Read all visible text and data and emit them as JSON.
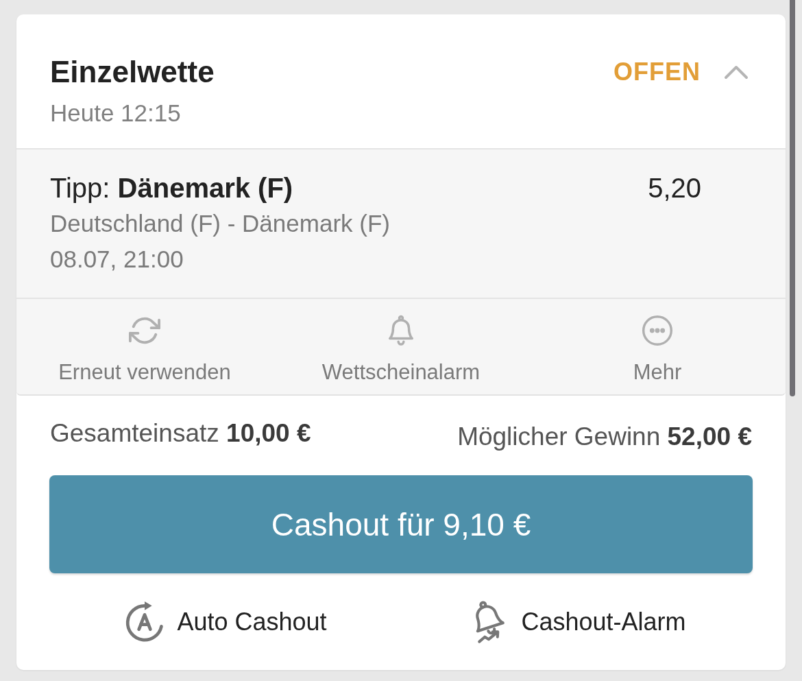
{
  "bet": {
    "type": "Einzelwette",
    "placed": "Heute 12:15",
    "status": "OFFEN",
    "expanded": true
  },
  "selection": {
    "tip": "Tipp: **Dänemark (F)**",
    "odds": "5,20",
    "event": "Deutschland (F) - Dänemark (F)",
    "date": "08.07, 21:00"
  },
  "actions": [
    {
      "kind": "reuse",
      "label": "Erneut verwenden"
    },
    {
      "kind": "alert",
      "label": "Wettscheinalarm"
    },
    {
      "kind": "more",
      "label": "Mehr"
    }
  ],
  "totals": {
    "stake": "Gesamteinsatz **10,00 €**",
    "payout": "Möglicher Gewinn **52,00 €**"
  },
  "cashout_button": "Cashout für 9,10 €",
  "options": [
    {
      "kind": "auto",
      "label": "Auto Cashout"
    },
    {
      "kind": "alarm",
      "label": "Cashout-Alarm"
    }
  ]
}
